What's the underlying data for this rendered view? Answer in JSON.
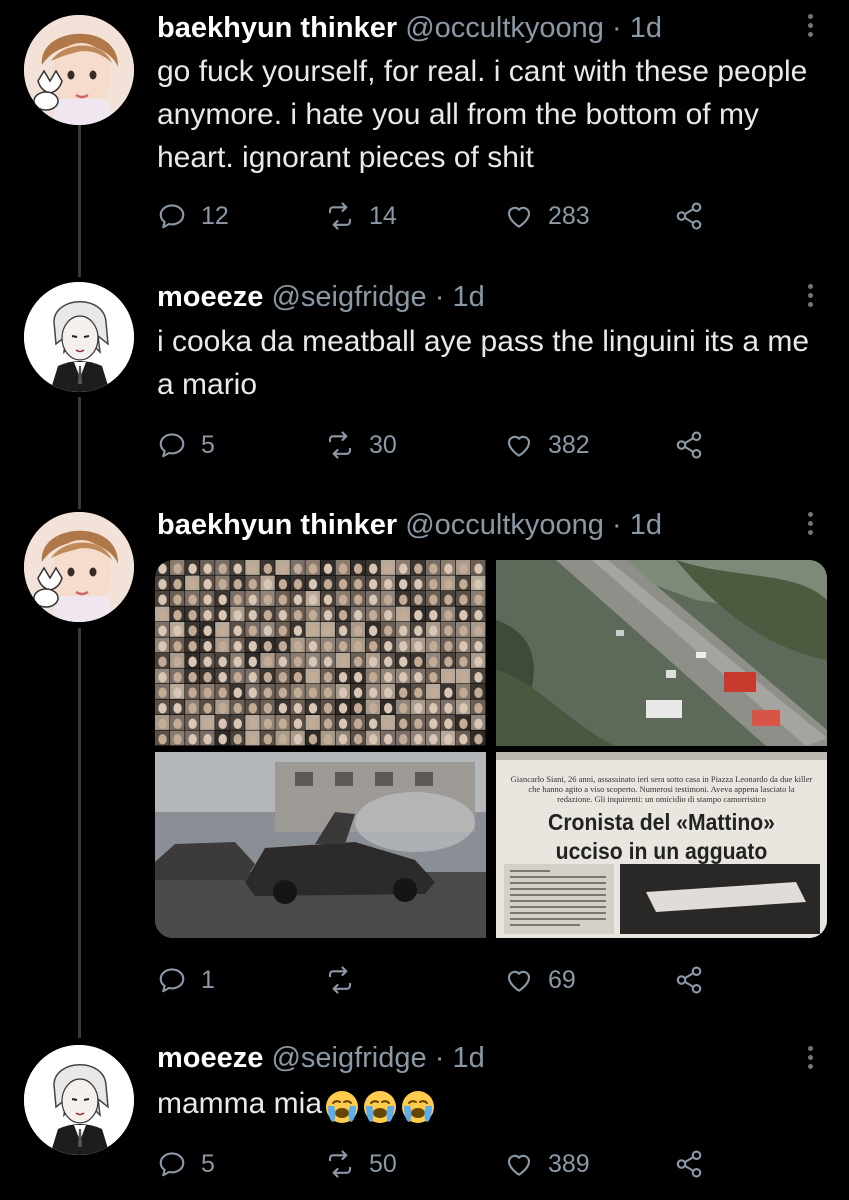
{
  "tweets": [
    {
      "display_name": "baekhyun thinker",
      "handle": "@occultkyoong",
      "separator": "·",
      "time": "1d",
      "text": "go fuck yourself, for real. i cant with these people anymore. i hate you all from the bottom of my heart. ignorant pieces of shit",
      "replies": "12",
      "retweets": "14",
      "likes": "283"
    },
    {
      "display_name": "moeeze",
      "handle": "@seigfridge",
      "separator": "·",
      "time": "1d",
      "text": "i cooka da meatball aye pass the linguini its a me a mario",
      "replies": "5",
      "retweets": "30",
      "likes": "382"
    },
    {
      "display_name": "baekhyun thinker",
      "handle": "@occultkyoong",
      "separator": "·",
      "time": "1d",
      "media": {
        "newspaper_caption": "Giancarlo Siani, 26 anni, assassinato ieri sera sotto casa in Piazza Leonardo da due killer che hanno agito a viso scoperto. Numerosi testimoni. Aveva appena lasciato la redazione. Gli inquirenti: un omicidio di stampo camorristico",
        "newspaper_headline_1": "Cronista del «Mattino»",
        "newspaper_headline_2": "ucciso in un agguato"
      },
      "replies": "1",
      "retweets": "",
      "likes": "69"
    },
    {
      "display_name": "moeeze",
      "handle": "@seigfridge",
      "separator": "·",
      "time": "1d",
      "text": "mamma mia",
      "emoji": [
        "loudly-crying-face",
        "loudly-crying-face",
        "loudly-crying-face"
      ],
      "replies": "5",
      "retweets": "50",
      "likes": "389"
    }
  ],
  "colors": {
    "background": "#000000",
    "muted": "#8b98a5",
    "thread_line": "#3a3a3a"
  }
}
